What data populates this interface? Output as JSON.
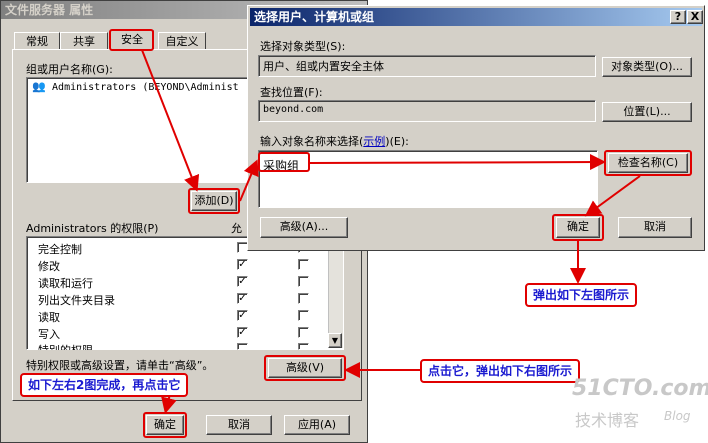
{
  "left_window": {
    "title": "文件服务器 属性",
    "tabs": [
      "常规",
      "共享",
      "安全",
      "自定义"
    ],
    "group_label": "组或用户名称(G):",
    "group_entry": "Administrators (BEYOND\\Administ",
    "add_button": "添加(D)",
    "perm_header": "Administrators 的权限(P)",
    "allow_header": "允",
    "permissions": [
      "完全控制",
      "修改",
      "读取和运行",
      "列出文件夹目录",
      "读取",
      "写入",
      "特别的权限"
    ],
    "allow_checked": [
      false,
      true,
      true,
      true,
      true,
      true,
      false
    ],
    "special_note": "特别权限或高级设置，请单击“高级”。",
    "advanced_button": "高级(V)",
    "ok_button": "确定",
    "cancel_button": "取消",
    "apply_button": "应用(A)"
  },
  "dialog": {
    "title": "选择用户、计算机或组",
    "help_btn": "?",
    "close_btn": "X",
    "object_type_label": "选择对象类型(S):",
    "object_type_value": "用户、组或内置安全主体",
    "object_type_button": "对象类型(O)...",
    "location_label": "查找位置(F):",
    "location_value": "beyond.com",
    "location_button": "位置(L)...",
    "input_label_prefix": "输入对象名称来选择(",
    "input_label_link": "示例",
    "input_label_suffix": ")(E):",
    "input_value": "采购组",
    "check_names_button": "检查名称(C)",
    "advanced_button": "高级(A)...",
    "ok_button": "确定",
    "cancel_button": "取消"
  },
  "annotations": {
    "popup_left": "弹出如下左图所示",
    "click_it": "点击它，弹出如下右图所示",
    "done_click": "如下左右2图完成，再点击它"
  },
  "watermark": {
    "logo": "51CTO.com",
    "sub": "技术博客",
    "blog": "Blog"
  }
}
